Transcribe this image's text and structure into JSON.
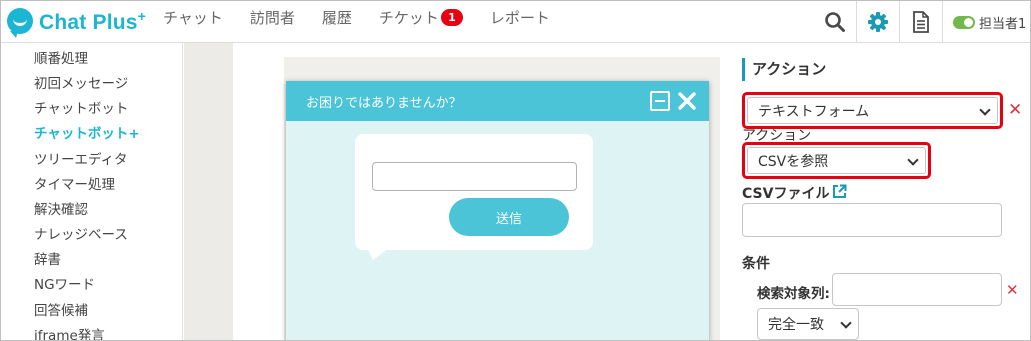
{
  "app": {
    "brand": "Chat Plus",
    "brand_mark": "+"
  },
  "nav": {
    "items": [
      {
        "label": "チャット"
      },
      {
        "label": "訪問者"
      },
      {
        "label": "履歴"
      },
      {
        "label": "チケット",
        "badge": "1"
      },
      {
        "label": "レポート"
      }
    ]
  },
  "toolbar": {
    "icons": [
      "search-icon",
      "gear-icon",
      "document-icon"
    ],
    "agent_label": "担当者1",
    "agent_status_color": "#72b84c",
    "accent_color": "#1cb6d4"
  },
  "sidebar": {
    "items": [
      {
        "label": "順番処理"
      },
      {
        "label": "初回メッセージ"
      },
      {
        "label": "チャットボット"
      },
      {
        "label": "チャットボット+",
        "active": true
      },
      {
        "label": "ツリーエディタ"
      },
      {
        "label": "タイマー処理"
      },
      {
        "label": "解決確認"
      },
      {
        "label": "ナレッジベース"
      },
      {
        "label": "辞書"
      },
      {
        "label": "NGワード"
      },
      {
        "label": "回答候補"
      },
      {
        "label": "iframe発言"
      }
    ]
  },
  "widget": {
    "title": "お困りではありませんか？",
    "input_value": "",
    "send_label": "送信",
    "header_color": "#4bc4d8"
  },
  "settings": {
    "section_title": "アクション",
    "action_select": "テキストフォーム",
    "action_label": "アクション",
    "action_type_select": "CSVを参照",
    "csv_file_label": "CSVファイル",
    "csv_file_value": "",
    "condition_label": "条件",
    "search_column_label": "検索対象列:",
    "search_column_value": "",
    "match_select": "完全一致",
    "highlight_color": "#e60012",
    "delete_color": "#d9363e"
  }
}
